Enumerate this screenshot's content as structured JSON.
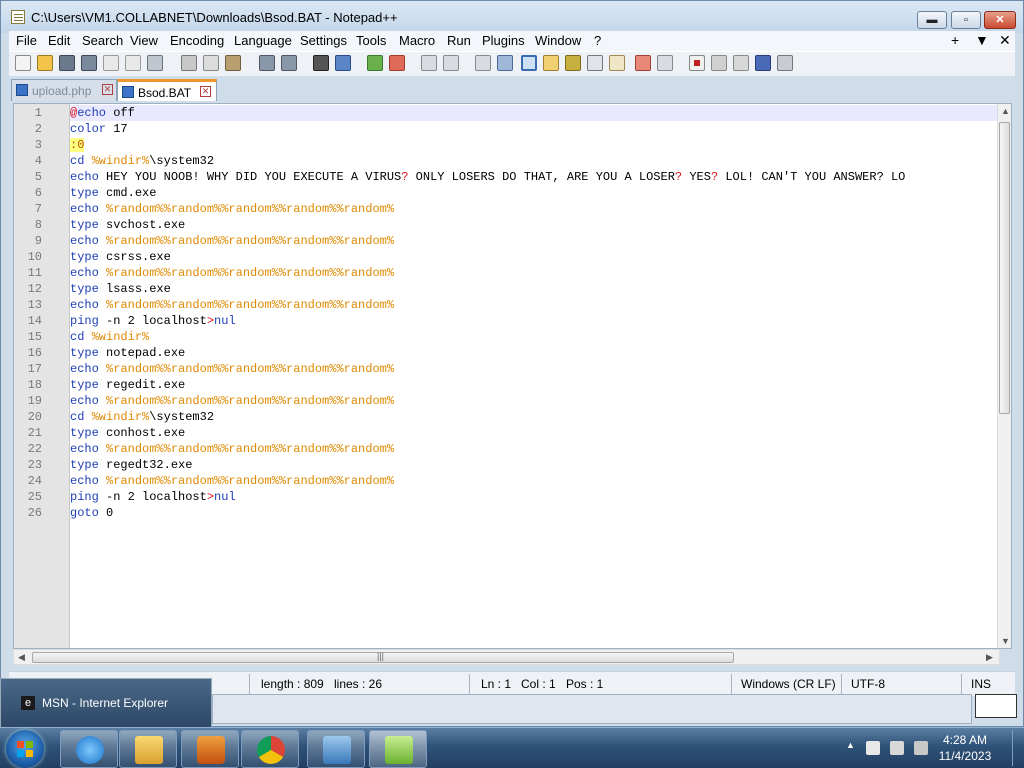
{
  "window": {
    "title": "C:\\Users\\VM1.COLLABNET\\Downloads\\Bsod.BAT - Notepad++",
    "min_label": "▬",
    "max_label": "▫",
    "close_label": "✕"
  },
  "menu": {
    "items": [
      "File",
      "Edit",
      "Search",
      "View",
      "Encoding",
      "Language",
      "Settings",
      "Tools",
      "Macro",
      "Run",
      "Plugins",
      "Window",
      "?"
    ],
    "right": [
      "+",
      "▼",
      "✕"
    ]
  },
  "toolbar_icons": [
    "new-file-icon",
    "open-file-icon",
    "save-icon",
    "save-all-icon",
    "close-icon",
    "close-all-icon",
    "print-icon",
    "cut-icon",
    "copy-icon",
    "paste-icon",
    "undo-icon",
    "redo-icon",
    "find-icon",
    "replace-icon",
    "zoom-in-icon",
    "zoom-out-icon",
    "sync-v-icon",
    "sync-h-icon",
    "word-wrap-icon",
    "show-all-chars-icon",
    "indent-guide-icon",
    "udl-icon",
    "doc-map-icon",
    "function-list-icon",
    "folder-workspace-icon",
    "monitor-icon",
    "record-macro-icon",
    "stop-macro-icon",
    "play-macro-icon",
    "play-multiple-icon",
    "save-macro-icon"
  ],
  "tabs": [
    {
      "label": "upload.php",
      "active": false
    },
    {
      "label": "Bsod.BAT",
      "active": true
    }
  ],
  "editor": {
    "lines": [
      [
        {
          "t": "@",
          "c": "red"
        },
        {
          "t": "echo",
          "c": "kw"
        },
        {
          "t": " off",
          "c": ""
        }
      ],
      [
        {
          "t": "color",
          "c": "kw"
        },
        {
          "t": " 17",
          "c": ""
        }
      ],
      [
        {
          "t": ":0",
          "c": "label"
        }
      ],
      [
        {
          "t": "cd",
          "c": "kw"
        },
        {
          "t": " ",
          "c": ""
        },
        {
          "t": "%windir%",
          "c": "var"
        },
        {
          "t": "\\system32",
          "c": ""
        }
      ],
      [
        {
          "t": "echo",
          "c": "kw"
        },
        {
          "t": " HEY YOU NOOB! WHY DID YOU EXECUTE A VIRUS",
          "c": ""
        },
        {
          "t": "?",
          "c": "red"
        },
        {
          "t": " ONLY LOSERS DO THAT, ARE YOU A LOSER",
          "c": ""
        },
        {
          "t": "?",
          "c": "red"
        },
        {
          "t": " YES",
          "c": ""
        },
        {
          "t": "?",
          "c": "red"
        },
        {
          "t": " LOL! CAN'T YOU ANSWER? LO",
          "c": ""
        }
      ],
      [
        {
          "t": "type",
          "c": "kw"
        },
        {
          "t": " cmd.exe",
          "c": ""
        }
      ],
      [
        {
          "t": "echo",
          "c": "kw"
        },
        {
          "t": " ",
          "c": ""
        },
        {
          "t": "%random%%random%%random%%random%%random%",
          "c": "var"
        }
      ],
      [
        {
          "t": "type",
          "c": "kw"
        },
        {
          "t": " svchost.exe",
          "c": ""
        }
      ],
      [
        {
          "t": "echo",
          "c": "kw"
        },
        {
          "t": " ",
          "c": ""
        },
        {
          "t": "%random%%random%%random%%random%%random%",
          "c": "var"
        }
      ],
      [
        {
          "t": "type",
          "c": "kw"
        },
        {
          "t": " csrss.exe",
          "c": ""
        }
      ],
      [
        {
          "t": "echo",
          "c": "kw"
        },
        {
          "t": " ",
          "c": ""
        },
        {
          "t": "%random%%random%%random%%random%%random%",
          "c": "var"
        }
      ],
      [
        {
          "t": "type",
          "c": "kw"
        },
        {
          "t": " lsass.exe",
          "c": ""
        }
      ],
      [
        {
          "t": "echo",
          "c": "kw"
        },
        {
          "t": " ",
          "c": ""
        },
        {
          "t": "%random%%random%%random%%random%%random%",
          "c": "var"
        }
      ],
      [
        {
          "t": "ping",
          "c": "kw"
        },
        {
          "t": " -n 2 localhost",
          "c": ""
        },
        {
          "t": ">",
          "c": "red"
        },
        {
          "t": "nul",
          "c": "kw"
        }
      ],
      [
        {
          "t": "cd",
          "c": "kw"
        },
        {
          "t": " ",
          "c": ""
        },
        {
          "t": "%windir%",
          "c": "var"
        }
      ],
      [
        {
          "t": "type",
          "c": "kw"
        },
        {
          "t": " notepad.exe",
          "c": ""
        }
      ],
      [
        {
          "t": "echo",
          "c": "kw"
        },
        {
          "t": " ",
          "c": ""
        },
        {
          "t": "%random%%random%%random%%random%%random%",
          "c": "var"
        }
      ],
      [
        {
          "t": "type",
          "c": "kw"
        },
        {
          "t": " regedit.exe",
          "c": ""
        }
      ],
      [
        {
          "t": "echo",
          "c": "kw"
        },
        {
          "t": " ",
          "c": ""
        },
        {
          "t": "%random%%random%%random%%random%%random%",
          "c": "var"
        }
      ],
      [
        {
          "t": "cd",
          "c": "kw"
        },
        {
          "t": " ",
          "c": ""
        },
        {
          "t": "%windir%",
          "c": "var"
        },
        {
          "t": "\\system32",
          "c": ""
        }
      ],
      [
        {
          "t": "type",
          "c": "kw"
        },
        {
          "t": " conhost.exe",
          "c": ""
        }
      ],
      [
        {
          "t": "echo",
          "c": "kw"
        },
        {
          "t": " ",
          "c": ""
        },
        {
          "t": "%random%%random%%random%%random%%random%",
          "c": "var"
        }
      ],
      [
        {
          "t": "type",
          "c": "kw"
        },
        {
          "t": " regedt32.exe",
          "c": ""
        }
      ],
      [
        {
          "t": "echo",
          "c": "kw"
        },
        {
          "t": " ",
          "c": ""
        },
        {
          "t": "%random%%random%%random%%random%%random%",
          "c": "var"
        }
      ],
      [
        {
          "t": "ping",
          "c": "kw"
        },
        {
          "t": " -n 2 localhost",
          "c": ""
        },
        {
          "t": ">",
          "c": "red"
        },
        {
          "t": "nul",
          "c": "kw"
        }
      ],
      [
        {
          "t": "goto",
          "c": "kw"
        },
        {
          "t": " 0",
          "c": ""
        }
      ]
    ]
  },
  "hscroll_handle": "|||",
  "status": {
    "length": "length : 809",
    "lines": "lines : 26",
    "ln": "Ln : 1",
    "col": "Col : 1",
    "pos": "Pos : 1",
    "eol": "Windows (CR LF)",
    "encoding": "UTF-8",
    "mode": "INS"
  },
  "thumbnail_popup": {
    "label": "MSN - Internet Explorer"
  },
  "taskbar": {
    "apps": [
      "internet-explorer-icon",
      "file-explorer-icon",
      "media-player-icon",
      "chrome-icon",
      "remote-desktop-icon",
      "notepad-plus-plus-icon"
    ],
    "time": "4:28 AM",
    "date": "11/4/2023",
    "tray_up": "▲"
  },
  "colors": {
    "keyword": "#1f3fb8",
    "variable": "#e08a00",
    "operator": "#e0101a",
    "label_bg": "#ffff80"
  }
}
